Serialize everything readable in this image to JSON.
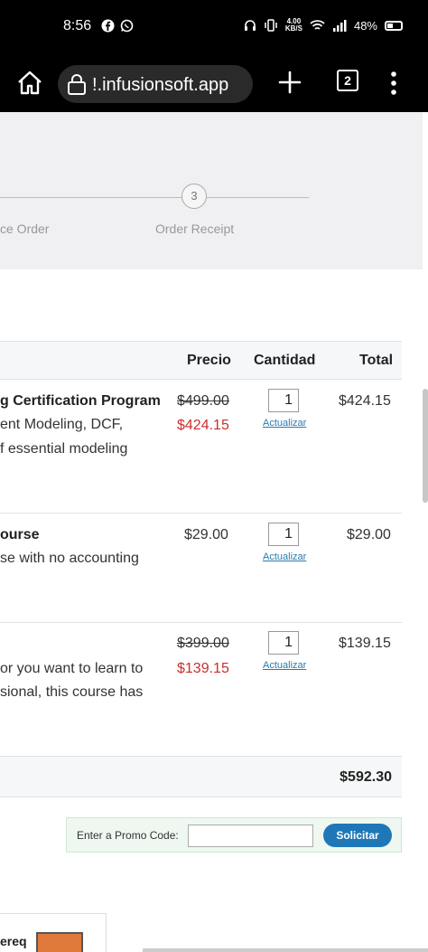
{
  "status_bar": {
    "time": "8:56",
    "net_speed_value": "4.00",
    "net_speed_unit": "KB/S",
    "battery": "48%"
  },
  "browser": {
    "url": "!.infusionsoft.app",
    "tab_count": "2"
  },
  "steps": {
    "previous_label": "ce Order",
    "receipt_number": "3",
    "receipt_label": "Order Receipt"
  },
  "cart": {
    "headers": {
      "price": "Precio",
      "quantity": "Cantidad",
      "total": "Total"
    },
    "items": [
      {
        "name": "g Certification Program",
        "desc_1": "ent Modeling, DCF,",
        "desc_2": "f essential modeling",
        "price_old": "$499.00",
        "price_new": "$424.15",
        "qty": "1",
        "update": "Actualizar",
        "total": "$424.15"
      },
      {
        "name": "ourse",
        "desc_1": "se with no accounting",
        "price": "$29.00",
        "qty": "1",
        "update": "Actualizar",
        "total": "$29.00"
      },
      {
        "desc_1": " or you want to learn to",
        "desc_2": "sional, this course has",
        "price_old": "$399.00",
        "price_new": "$139.15",
        "qty": "1",
        "update": "Actualizar",
        "total": "$139.15"
      }
    ],
    "grand_total": "$592.30"
  },
  "promo": {
    "label": "Enter a Promo Code:",
    "value": "",
    "button": "Solicitar"
  },
  "bottom": {
    "card_title": "ereq"
  },
  "colors": {
    "sale_price": "#c9302c",
    "link": "#2a7ab0",
    "button": "#1e78b8",
    "promo_bg": "#eef8f1"
  }
}
